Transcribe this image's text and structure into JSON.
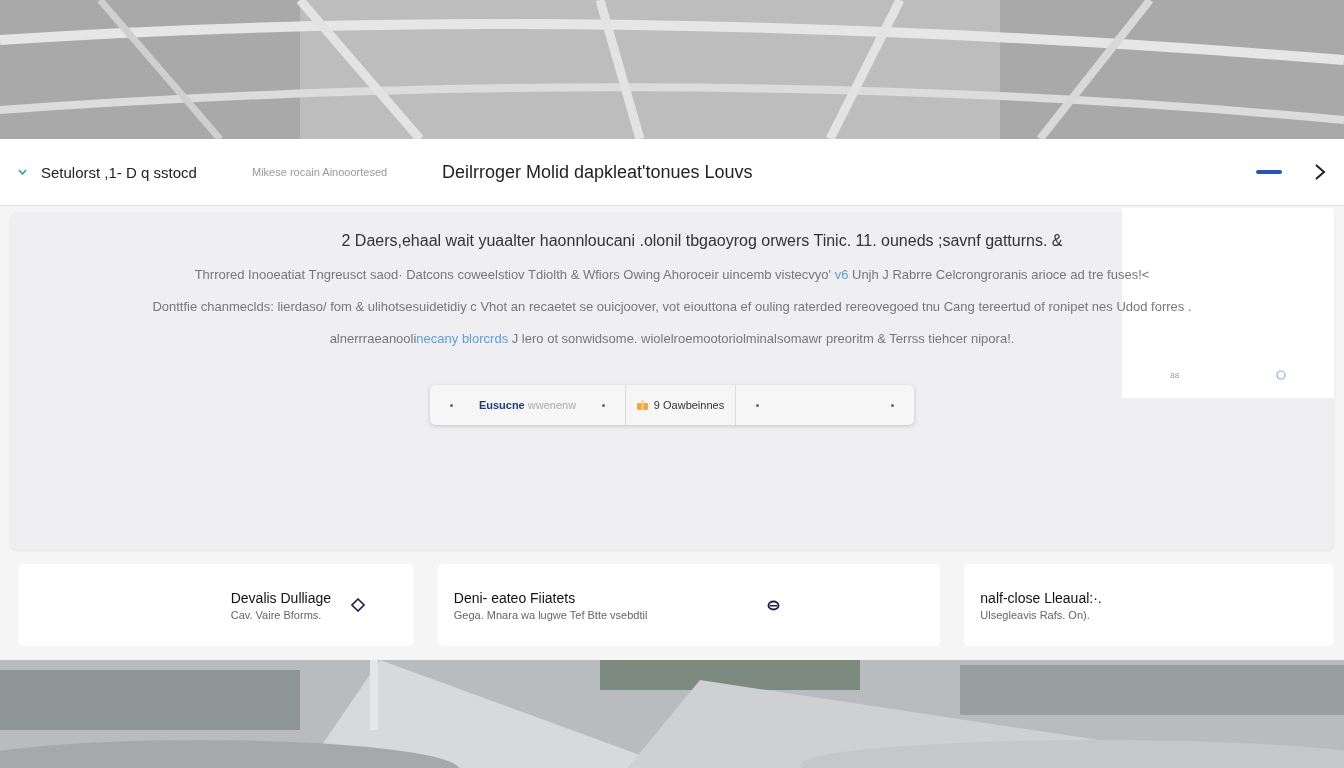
{
  "header": {
    "menu_label": "Setulorst ,1- D q sstocd",
    "subtitle": "Mikese rocain Ainooortesed",
    "title": "Deilrroger Molid dapkleat'tonues Louvs"
  },
  "hero": {
    "title": "2 Daers,ehaal wait yuaalter haonnloucani .olonil tbgaoyrog orwers Tinic. 11. ouneds ;savnf gatturns. &",
    "lines": [
      [
        {
          "text": "Thrrored Inooeatiat Tngreusct saod· Datcons coweelstiov Tdiolth & Wfiors Owing  Ahoroceir uincemb vistecvyo' ",
          "link": false
        },
        {
          "text": "v6",
          "link": true
        },
        {
          "text": " Unjh J Rabrre Celcrongroranis arioce ad tre fuses!<",
          "link": false
        }
      ],
      [
        {
          "text": "Donttfie chanmeclds: lierdaso/ fom & ulihotsesuidetidiy c Vhot an recaetet se ouicjoover, vot eiouttona ef ouling raterded rereovegoed tnu Cang tereertud of ronipet nes Udod forres .",
          "link": false
        }
      ],
      [
        {
          "text": "alnerrraeanooli",
          "link": false
        },
        {
          "text": "necany blorcrds",
          "link": true
        },
        {
          "text": " J lero ot sonwidsome. wiolelroemootoriolminalsomawr preoritm & Terrss tiehcer nipora!.",
          "link": false
        }
      ]
    ],
    "segments": [
      {
        "label": "Eusucne",
        "hint": "wwenenw",
        "kind": "text"
      },
      {
        "label": "9 Oawbeinnes",
        "kind": "icon"
      },
      {
        "kind": "empty"
      }
    ],
    "side_panel": {
      "caption": "88"
    }
  },
  "cards": [
    {
      "title": "Devalis Dulliage",
      "subtitle": "Cav. Vaire Bforms.",
      "kind": "diamond"
    },
    {
      "title": "Deni- eateo Fiiatets",
      "subtitle": "Gega. Mnara wa lugwe Tef Btte vsebdtil",
      "kind": "ring"
    },
    {
      "title": "nalf-close Lleaual:·.",
      "subtitle": "Ulsegleavis Rafs. On).",
      "kind": "plain"
    }
  ]
}
